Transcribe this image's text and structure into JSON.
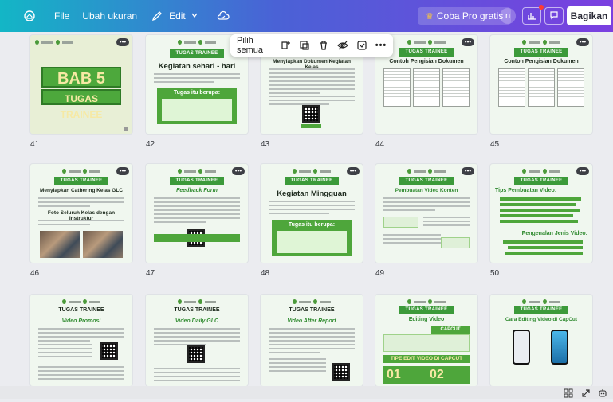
{
  "topbar": {
    "file_label": "File",
    "resize_label": "Ubah ukuran",
    "edit_label": "Edit",
    "pro_label": "Coba Pro gratis",
    "avatar_initial": "n",
    "share_label": "Bagikan"
  },
  "toolbar": {
    "select_all_label": "Pilih semua"
  },
  "pages": [
    {
      "num": "41",
      "title": "BAB 5",
      "subtitle": "TUGAS TRAINEE"
    },
    {
      "num": "42",
      "title": "Kegiatan sehari - hari",
      "box_title": "Tugas itu berupa:"
    },
    {
      "num": "43",
      "title": "Menyiapkan Dokumen Kegiatan Kelas"
    },
    {
      "num": "44",
      "ribbon": "TUGAS TRAINEE",
      "title": "Contoh Pengisian Dokumen"
    },
    {
      "num": "45",
      "ribbon": "TUGAS TRAINEE",
      "title": "Contoh Pengisian Dokumen"
    },
    {
      "num": "46",
      "ribbon": "TUGAS TRAINEE",
      "title": "Menyiapkan Cathering Kelas GLC",
      "title2": "Foto Seluruh Kelas dengan Instruktur"
    },
    {
      "num": "47",
      "ribbon": "TUGAS TRAINEE",
      "title": "Feedback Form"
    },
    {
      "num": "48",
      "ribbon": "TUGAS TRAINEE",
      "title": "Kegiatan Mingguan",
      "box_title": "Tugas itu berupa:"
    },
    {
      "num": "49",
      "ribbon": "TUGAS TRAINEE",
      "title": "Pembuatan Video Konten"
    },
    {
      "num": "50",
      "ribbon": "TUGAS TRAINEE",
      "title": "Tips Pembuatan Video:",
      "title2": "Pengenalan Jenis Video:"
    },
    {
      "num": "",
      "ribbon": "TUGAS TRAINEE",
      "title": "Video Promosi"
    },
    {
      "num": "",
      "ribbon": "TUGAS TRAINEE",
      "title": "Video Daily GLC"
    },
    {
      "num": "",
      "ribbon": "TUGAS TRAINEE",
      "title": "Video After Report"
    },
    {
      "num": "",
      "ribbon": "TUGAS TRAINEE",
      "title": "Editing Video",
      "banner": "CAPCUT",
      "banner2": "TIPE EDIT VIDEO DI CAPCUT"
    },
    {
      "num": "",
      "ribbon": "TUGAS TRAINEE",
      "title": "Cara Editing Video di CapCut"
    }
  ]
}
